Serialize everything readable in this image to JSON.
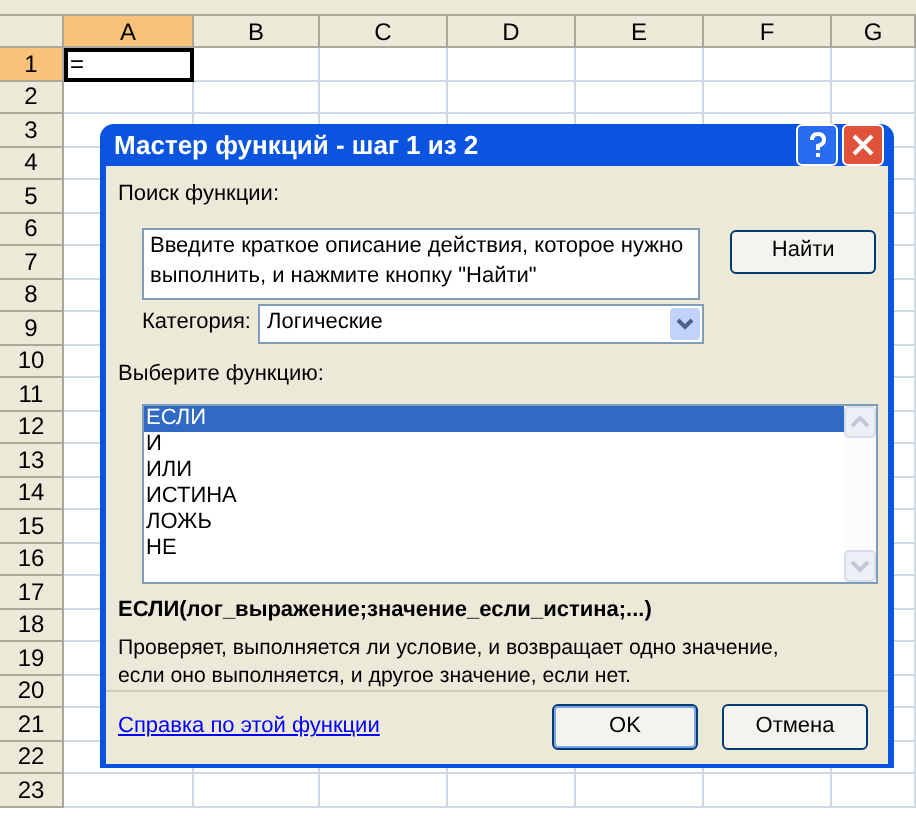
{
  "sheet": {
    "columns": [
      {
        "label": "A",
        "selected": true
      },
      {
        "label": "B",
        "selected": false
      },
      {
        "label": "C",
        "selected": false
      },
      {
        "label": "D",
        "selected": false
      },
      {
        "label": "E",
        "selected": false
      },
      {
        "label": "F",
        "selected": false
      },
      {
        "label": "G",
        "selected": false
      }
    ],
    "rows": [
      {
        "label": "1",
        "selected": true
      },
      {
        "label": "2",
        "selected": false
      },
      {
        "label": "3",
        "selected": false
      },
      {
        "label": "4",
        "selected": false
      },
      {
        "label": "5",
        "selected": false
      },
      {
        "label": "6",
        "selected": false
      },
      {
        "label": "7",
        "selected": false
      },
      {
        "label": "8",
        "selected": false
      },
      {
        "label": "9",
        "selected": false
      },
      {
        "label": "10",
        "selected": false
      },
      {
        "label": "11",
        "selected": false
      },
      {
        "label": "12",
        "selected": false
      },
      {
        "label": "13",
        "selected": false
      },
      {
        "label": "14",
        "selected": false
      },
      {
        "label": "15",
        "selected": false
      },
      {
        "label": "16",
        "selected": false
      },
      {
        "label": "17",
        "selected": false
      },
      {
        "label": "18",
        "selected": false
      },
      {
        "label": "19",
        "selected": false
      },
      {
        "label": "20",
        "selected": false
      },
      {
        "label": "21",
        "selected": false
      },
      {
        "label": "22",
        "selected": false
      },
      {
        "label": "23",
        "selected": false
      }
    ],
    "active_cell_value": "="
  },
  "dialog": {
    "title": "Мастер функций - шаг 1 из 2",
    "search_label": "Поиск функции:",
    "search_value": "Введите краткое описание действия, которое нужно выполнить, и нажмите кнопку \"Найти\"",
    "find_button": "Найти",
    "category_label": "Категория:",
    "category_value": "Логические",
    "list_label": "Выберите функцию:",
    "functions": [
      {
        "label": "ЕСЛИ",
        "selected": true
      },
      {
        "label": "И",
        "selected": false
      },
      {
        "label": "ИЛИ",
        "selected": false
      },
      {
        "label": "ИСТИНА",
        "selected": false
      },
      {
        "label": "ЛОЖЬ",
        "selected": false
      },
      {
        "label": "НЕ",
        "selected": false
      }
    ],
    "signature": "ЕСЛИ(лог_выражение;значение_если_истина;...)",
    "description": "Проверяет, выполняется ли условие, и возвращает одно значение, если оно выполняется, и другое значение, если нет.",
    "help_link": "Справка по этой функции",
    "ok_button": "OK",
    "cancel_button": "Отмена"
  }
}
